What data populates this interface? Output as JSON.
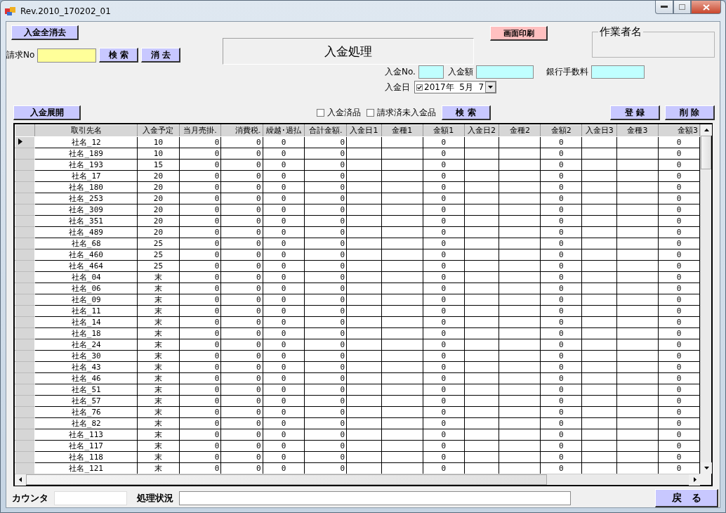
{
  "window": {
    "title": "Rev.2010_170202_01"
  },
  "toolbar": {
    "clear_all_button": "入金全消去",
    "invoice_label": "請求No",
    "search_button": "検 索",
    "clear_button": "消 去",
    "expand_button": "入金展開"
  },
  "form_title": "入金処理",
  "print_button": "画面印刷",
  "worker_group": {
    "title": "作業者名"
  },
  "payment": {
    "no_label": "入金No.",
    "amount_label": "入金額",
    "fee_label": "銀行手数料",
    "date_label": "入金日",
    "date": {
      "checked": true,
      "value": "2017年  5月  7"
    }
  },
  "filters": [
    {
      "label": "入金済品",
      "checked": false
    },
    {
      "label": "請求済未入金品",
      "checked": false
    }
  ],
  "filter_search_button": "検 索",
  "register_button": "登 録",
  "delete_button": "削 除",
  "table": {
    "columns": [
      "取引先名",
      "入金予定",
      "当月売掛.",
      "消費税.",
      "繰越･過払",
      "合計金額.",
      "入金日1",
      "金種1",
      "金額1",
      "入金日2",
      "金種2",
      "金額2",
      "入金日3",
      "金種3",
      "金額3"
    ],
    "rows": [
      {
        "selected": true,
        "name": "社名_12",
        "schedule": "10",
        "sales": "0",
        "tax": "0",
        "carryover": "0",
        "total": "0",
        "amount1": "0",
        "amount2": "0",
        "amount3": "0"
      },
      {
        "selected": false,
        "name": "社名_189",
        "schedule": "10",
        "sales": "0",
        "tax": "0",
        "carryover": "0",
        "total": "0",
        "amount1": "0",
        "amount2": "0",
        "amount3": "0"
      },
      {
        "selected": false,
        "name": "社名_193",
        "schedule": "15",
        "sales": "0",
        "tax": "0",
        "carryover": "0",
        "total": "0",
        "amount1": "0",
        "amount2": "0",
        "amount3": "0"
      },
      {
        "selected": false,
        "name": "社名_17",
        "schedule": "20",
        "sales": "0",
        "tax": "0",
        "carryover": "0",
        "total": "0",
        "amount1": "0",
        "amount2": "0",
        "amount3": "0"
      },
      {
        "selected": false,
        "name": "社名_180",
        "schedule": "20",
        "sales": "0",
        "tax": "0",
        "carryover": "0",
        "total": "0",
        "amount1": "0",
        "amount2": "0",
        "amount3": "0"
      },
      {
        "selected": false,
        "name": "社名_253",
        "schedule": "20",
        "sales": "0",
        "tax": "0",
        "carryover": "0",
        "total": "0",
        "amount1": "0",
        "amount2": "0",
        "amount3": "0"
      },
      {
        "selected": false,
        "name": "社名_309",
        "schedule": "20",
        "sales": "0",
        "tax": "0",
        "carryover": "0",
        "total": "0",
        "amount1": "0",
        "amount2": "0",
        "amount3": "0"
      },
      {
        "selected": false,
        "name": "社名_351",
        "schedule": "20",
        "sales": "0",
        "tax": "0",
        "carryover": "0",
        "total": "0",
        "amount1": "0",
        "amount2": "0",
        "amount3": "0"
      },
      {
        "selected": false,
        "name": "社名_489",
        "schedule": "20",
        "sales": "0",
        "tax": "0",
        "carryover": "0",
        "total": "0",
        "amount1": "0",
        "amount2": "0",
        "amount3": "0"
      },
      {
        "selected": false,
        "name": "社名_68",
        "schedule": "25",
        "sales": "0",
        "tax": "0",
        "carryover": "0",
        "total": "0",
        "amount1": "0",
        "amount2": "0",
        "amount3": "0"
      },
      {
        "selected": false,
        "name": "社名_460",
        "schedule": "25",
        "sales": "0",
        "tax": "0",
        "carryover": "0",
        "total": "0",
        "amount1": "0",
        "amount2": "0",
        "amount3": "0"
      },
      {
        "selected": false,
        "name": "社名_464",
        "schedule": "25",
        "sales": "0",
        "tax": "0",
        "carryover": "0",
        "total": "0",
        "amount1": "0",
        "amount2": "0",
        "amount3": "0"
      },
      {
        "selected": false,
        "name": "社名_04",
        "schedule": "末",
        "sales": "0",
        "tax": "0",
        "carryover": "0",
        "total": "0",
        "amount1": "0",
        "amount2": "0",
        "amount3": "0"
      },
      {
        "selected": false,
        "name": "社名_06",
        "schedule": "末",
        "sales": "0",
        "tax": "0",
        "carryover": "0",
        "total": "0",
        "amount1": "0",
        "amount2": "0",
        "amount3": "0"
      },
      {
        "selected": false,
        "name": "社名_09",
        "schedule": "末",
        "sales": "0",
        "tax": "0",
        "carryover": "0",
        "total": "0",
        "amount1": "0",
        "amount2": "0",
        "amount3": "0"
      },
      {
        "selected": false,
        "name": "社名_11",
        "schedule": "末",
        "sales": "0",
        "tax": "0",
        "carryover": "0",
        "total": "0",
        "amount1": "0",
        "amount2": "0",
        "amount3": "0"
      },
      {
        "selected": false,
        "name": "社名_14",
        "schedule": "末",
        "sales": "0",
        "tax": "0",
        "carryover": "0",
        "total": "0",
        "amount1": "0",
        "amount2": "0",
        "amount3": "0"
      },
      {
        "selected": false,
        "name": "社名_18",
        "schedule": "末",
        "sales": "0",
        "tax": "0",
        "carryover": "0",
        "total": "0",
        "amount1": "0",
        "amount2": "0",
        "amount3": "0"
      },
      {
        "selected": false,
        "name": "社名_24",
        "schedule": "末",
        "sales": "0",
        "tax": "0",
        "carryover": "0",
        "total": "0",
        "amount1": "0",
        "amount2": "0",
        "amount3": "0"
      },
      {
        "selected": false,
        "name": "社名_30",
        "schedule": "末",
        "sales": "0",
        "tax": "0",
        "carryover": "0",
        "total": "0",
        "amount1": "0",
        "amount2": "0",
        "amount3": "0"
      },
      {
        "selected": false,
        "name": "社名_43",
        "schedule": "末",
        "sales": "0",
        "tax": "0",
        "carryover": "0",
        "total": "0",
        "amount1": "0",
        "amount2": "0",
        "amount3": "0"
      },
      {
        "selected": false,
        "name": "社名_46",
        "schedule": "末",
        "sales": "0",
        "tax": "0",
        "carryover": "0",
        "total": "0",
        "amount1": "0",
        "amount2": "0",
        "amount3": "0"
      },
      {
        "selected": false,
        "name": "社名_51",
        "schedule": "末",
        "sales": "0",
        "tax": "0",
        "carryover": "0",
        "total": "0",
        "amount1": "0",
        "amount2": "0",
        "amount3": "0"
      },
      {
        "selected": false,
        "name": "社名_57",
        "schedule": "末",
        "sales": "0",
        "tax": "0",
        "carryover": "0",
        "total": "0",
        "amount1": "0",
        "amount2": "0",
        "amount3": "0"
      },
      {
        "selected": false,
        "name": "社名_76",
        "schedule": "末",
        "sales": "0",
        "tax": "0",
        "carryover": "0",
        "total": "0",
        "amount1": "0",
        "amount2": "0",
        "amount3": "0"
      },
      {
        "selected": false,
        "name": "社名_82",
        "schedule": "末",
        "sales": "0",
        "tax": "0",
        "carryover": "0",
        "total": "0",
        "amount1": "0",
        "amount2": "0",
        "amount3": "0"
      },
      {
        "selected": false,
        "name": "社名_113",
        "schedule": "末",
        "sales": "0",
        "tax": "0",
        "carryover": "0",
        "total": "0",
        "amount1": "0",
        "amount2": "0",
        "amount3": "0"
      },
      {
        "selected": false,
        "name": "社名_117",
        "schedule": "末",
        "sales": "0",
        "tax": "0",
        "carryover": "0",
        "total": "0",
        "amount1": "0",
        "amount2": "0",
        "amount3": "0"
      },
      {
        "selected": false,
        "name": "社名_118",
        "schedule": "末",
        "sales": "0",
        "tax": "0",
        "carryover": "0",
        "total": "0",
        "amount1": "0",
        "amount2": "0",
        "amount3": "0"
      },
      {
        "selected": false,
        "name": "社名_121",
        "schedule": "末",
        "sales": "0",
        "tax": "0",
        "carryover": "0",
        "total": "0",
        "amount1": "0",
        "amount2": "0",
        "amount3": "0"
      }
    ]
  },
  "status_bar": {
    "counter_label": "カウンタ",
    "status_label": "処理状況",
    "back_button": "戻　る"
  }
}
